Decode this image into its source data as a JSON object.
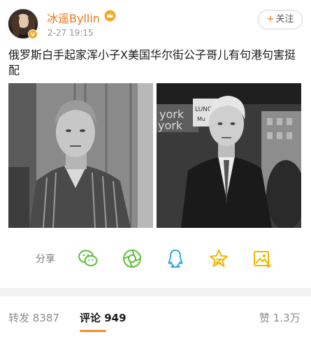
{
  "post": {
    "username": "冰遥Byllin",
    "time": "2-27 19:15",
    "follow_label": "关注",
    "follow_plus": "+",
    "text": "俄罗斯白手起家浑小子X美国华尔街公子哥儿有句港句害挺配"
  },
  "share": {
    "label": "分享",
    "icons": [
      "wechat-icon",
      "moments-icon",
      "qq-icon",
      "qzone-star-icon",
      "save-image-icon"
    ]
  },
  "stats": {
    "repost": "转发 8387",
    "comment": "评论 949",
    "like": "赞 1.3万"
  },
  "colors": {
    "accent_orange": "#e8741c",
    "share_green": "#5cbf3a",
    "share_blue": "#2fa8dd",
    "share_yellow": "#f2b400"
  }
}
